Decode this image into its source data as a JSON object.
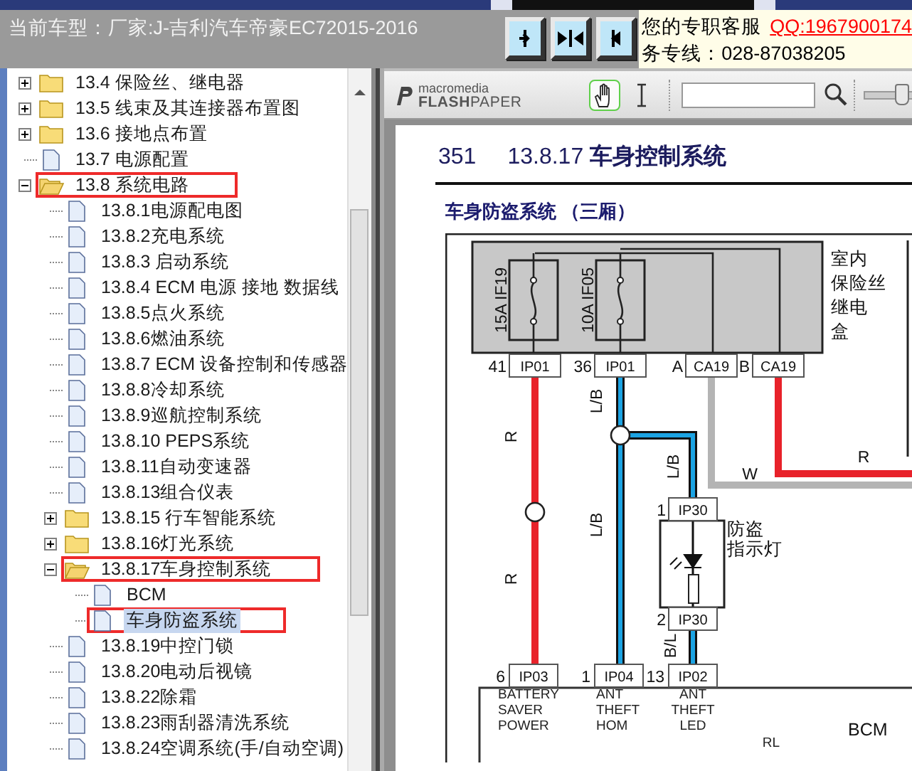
{
  "header": {
    "model": "当前车型：厂家:J-吉利汽车帝豪EC72015-2016",
    "layout_buttons": [
      {
        "kind": "right"
      },
      {
        "kind": "both"
      },
      {
        "kind": "left"
      }
    ],
    "service": {
      "label": "您的专职客服",
      "qq": "QQ:1967900174",
      "hotline": "务专线：028-87038205"
    }
  },
  "tree": [
    {
      "label": "13.4 保险丝、继电器",
      "kind": "folder",
      "expanded": false,
      "selected": false,
      "highlighted": false
    },
    {
      "label": "13.5 线束及其连接器布置图",
      "kind": "folder",
      "expanded": false,
      "selected": false,
      "highlighted": false
    },
    {
      "label": "13.6 接地点布置",
      "kind": "folder",
      "expanded": false,
      "selected": false,
      "highlighted": false
    },
    {
      "label": "13.7 电源配置",
      "kind": "doc",
      "selected": false,
      "highlighted": false
    },
    {
      "label": "13.8 系统电路",
      "kind": "folder",
      "expanded": true,
      "selected": false,
      "highlighted": true,
      "children": [
        {
          "label": "13.8.1电源配电图",
          "kind": "doc",
          "selected": false,
          "highlighted": false
        },
        {
          "label": "13.8.2充电系统",
          "kind": "doc",
          "selected": false,
          "highlighted": false
        },
        {
          "label": "13.8.3 启动系统",
          "kind": "doc",
          "selected": false,
          "highlighted": false
        },
        {
          "label": "13.8.4 ECM 电源 接地 数据线",
          "kind": "doc",
          "selected": false,
          "highlighted": false
        },
        {
          "label": "13.8.5点火系统",
          "kind": "doc",
          "selected": false,
          "highlighted": false
        },
        {
          "label": "13.8.6燃油系统",
          "kind": "doc",
          "selected": false,
          "highlighted": false
        },
        {
          "label": "13.8.7 ECM 设备控制和传感器",
          "kind": "doc",
          "selected": false,
          "highlighted": false
        },
        {
          "label": "13.8.8冷却系统",
          "kind": "doc",
          "selected": false,
          "highlighted": false
        },
        {
          "label": "13.8.9巡航控制系统",
          "kind": "doc",
          "selected": false,
          "highlighted": false
        },
        {
          "label": "13.8.10 PEPS系统",
          "kind": "doc",
          "selected": false,
          "highlighted": false
        },
        {
          "label": "13.8.11自动变速器",
          "kind": "doc",
          "selected": false,
          "highlighted": false
        },
        {
          "label": "13.8.13组合仪表",
          "kind": "doc",
          "selected": false,
          "highlighted": false
        },
        {
          "label": "13.8.15 行车智能系统",
          "kind": "folder",
          "expanded": false,
          "selected": false,
          "highlighted": false
        },
        {
          "label": "13.8.16灯光系统",
          "kind": "folder",
          "expanded": false,
          "selected": false,
          "highlighted": false
        },
        {
          "label": "13.8.17车身控制系统",
          "kind": "folder",
          "expanded": true,
          "selected": false,
          "highlighted": true,
          "children": [
            {
              "label": "BCM",
              "kind": "doc",
              "selected": false,
              "highlighted": false
            },
            {
              "label": "车身防盗系统",
              "kind": "doc",
              "selected": true,
              "highlighted": true
            }
          ]
        },
        {
          "label": "13.8.19中控门锁",
          "kind": "doc",
          "selected": false,
          "highlighted": false
        },
        {
          "label": "13.8.20电动后视镜",
          "kind": "doc",
          "selected": false,
          "highlighted": false
        },
        {
          "label": "13.8.22除霜",
          "kind": "doc",
          "selected": false,
          "highlighted": false
        },
        {
          "label": "13.8.23雨刮器清洗系统",
          "kind": "doc",
          "selected": false,
          "highlighted": false
        },
        {
          "label": "13.8.24空调系统(手/自动空调)",
          "kind": "doc",
          "selected": false,
          "highlighted": false
        }
      ]
    }
  ],
  "viewer_toolbar": {
    "logo_small": "macromedia",
    "logo_large": "**FLASH**PAPER",
    "tools": [
      {
        "kind": "hand",
        "selected": true
      },
      {
        "kind": "text",
        "selected": false
      }
    ],
    "zoom": {
      "level": 0.6
    }
  },
  "document": {
    "page_number": "351",
    "title": "13.8.17 **车身控制系统**",
    "subtitle": "车身防盗系统 （三厢）",
    "diagram": {
      "fuse_box_label": [
        "室内",
        "保险丝",
        "继电",
        "盒"
      ],
      "fuses": [
        {
          "rating": "15A",
          "name": "IF19"
        },
        {
          "rating": "10A",
          "name": "IF05"
        }
      ],
      "top_connectors": [
        {
          "pin": "41",
          "name": "IP01"
        },
        {
          "pin": "36",
          "name": "IP01"
        },
        {
          "pin": "A",
          "name": "CA19"
        },
        {
          "pin": "B",
          "name": "CA19"
        }
      ],
      "wires": [
        {
          "color": "#e8222a",
          "labels": [
            "R",
            "R"
          ]
        },
        {
          "color": "#1ba3e3",
          "labels": [
            "L/B",
            "L/B"
          ]
        },
        {
          "color": "#1ba3e3",
          "labels": [
            "L/B"
          ]
        },
        {
          "color": "#1ba3e3",
          "labels": [
            "B/L"
          ]
        },
        {
          "color": "#b4b4b4",
          "labels": [
            "W"
          ]
        },
        {
          "color": "#e8222a",
          "labels": [
            "R"
          ]
        }
      ],
      "indicator": {
        "label": [
          "防盗",
          "指示灯"
        ],
        "top": {
          "pin": "1",
          "name": "IP30"
        },
        "bottom": {
          "pin": "2",
          "name": "IP30"
        }
      },
      "bottom_connectors": [
        {
          "pin": "6",
          "name": "IP03"
        },
        {
          "pin": "1",
          "name": "IP04"
        },
        {
          "pin": "13",
          "name": "IP02"
        }
      ],
      "bcm": {
        "name": "BCM",
        "terminals": [
          [
            "BATTERY",
            "SAVER",
            "POWER"
          ],
          [
            "ANT",
            "THEFT",
            "HOM"
          ],
          [
            "ANT",
            "THEFT",
            "LED"
          ],
          [
            "RL"
          ]
        ]
      }
    }
  }
}
